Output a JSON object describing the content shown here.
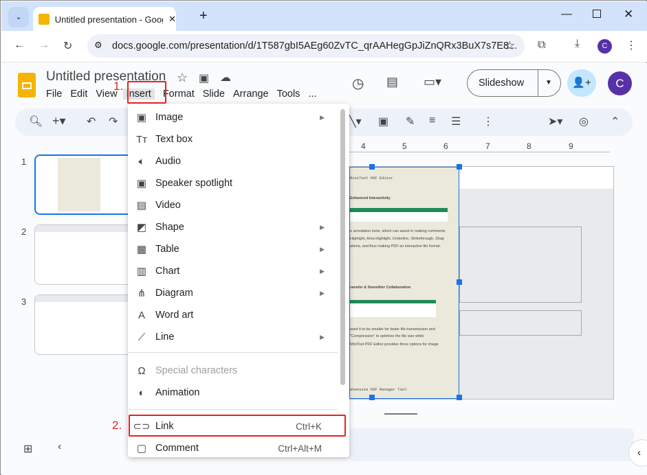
{
  "browser": {
    "tab_title": "Untitled presentation - Google Slides",
    "url": "docs.google.com/presentation/d/1T587gbI5AEg60ZvTC_qrAAHegGpJiZnQRx3BuX7s7E8...",
    "profile_initial": "C"
  },
  "app": {
    "doc_title": "Untitled presentation",
    "menus": [
      "File",
      "Edit",
      "View",
      "Insert",
      "Format",
      "Slide",
      "Arrange",
      "Tools",
      "..."
    ],
    "slideshow_label": "Slideshow",
    "avatar_initial": "C"
  },
  "slides": [
    "1",
    "2",
    "3"
  ],
  "ruler": [
    "4",
    "5",
    "6",
    "7",
    "8",
    "9"
  ],
  "slide_text": {
    "header": "MiniTool PDF Editor",
    "h1": "Enhanced Interactivity",
    "p1": [
      "e annotation tools, which can assist in making comments",
      "Highlight, Area Highlight, Underline, Strikethrough, Shap",
      "ations, and thus making PDF an interactive file format."
    ],
    "h2": "ransfer & Smoother Collaboration",
    "p2": [
      "want it to be smaller for faster file transmission and",
      "\"Compression\" to optimize the file size while",
      "MiniTool PDF Editor provides three options for image"
    ],
    "footer": "ehensive PDF Manager Tool"
  },
  "insert_menu": {
    "items": [
      {
        "label": "Image",
        "icon": "image-icon",
        "submenu": true
      },
      {
        "label": "Text box",
        "icon": "text-box-icon"
      },
      {
        "label": "Audio",
        "icon": "audio-icon"
      },
      {
        "label": "Speaker spotlight",
        "icon": "speaker-spotlight-icon"
      },
      {
        "label": "Video",
        "icon": "video-icon"
      },
      {
        "label": "Shape",
        "icon": "shape-icon",
        "submenu": true
      },
      {
        "label": "Table",
        "icon": "table-icon",
        "submenu": true
      },
      {
        "label": "Chart",
        "icon": "chart-icon",
        "submenu": true
      },
      {
        "label": "Diagram",
        "icon": "diagram-icon",
        "submenu": true
      },
      {
        "label": "Word art",
        "icon": "word-art-icon"
      },
      {
        "label": "Line",
        "icon": "line-icon",
        "submenu": true
      },
      {
        "label": "Special characters",
        "icon": "omega-icon",
        "disabled": true
      },
      {
        "label": "Animation",
        "icon": "animation-icon"
      },
      {
        "label": "Link",
        "icon": "link-icon",
        "shortcut": "Ctrl+K"
      },
      {
        "label": "Comment",
        "icon": "comment-icon",
        "shortcut": "Ctrl+Alt+M"
      }
    ]
  },
  "annotations": {
    "step1": "1.",
    "step2": "2.",
    "color": "#e8221c"
  }
}
